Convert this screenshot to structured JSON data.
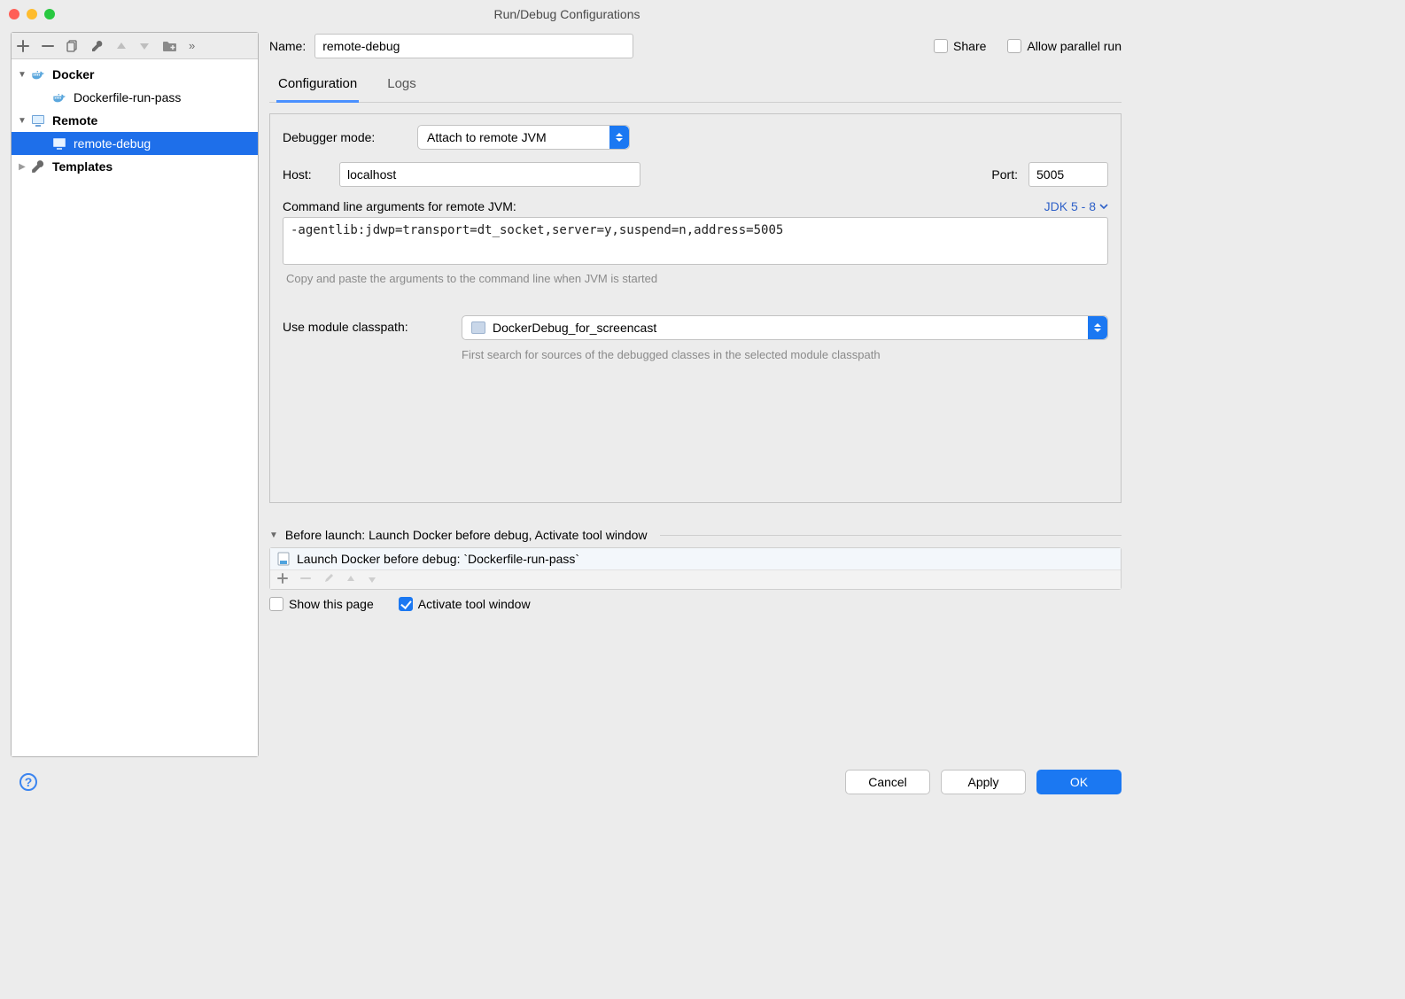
{
  "title": "Run/Debug Configurations",
  "tree": {
    "docker_label": "Docker",
    "docker_item": "Dockerfile-run-pass",
    "remote_label": "Remote",
    "remote_item": "remote-debug",
    "templates_label": "Templates"
  },
  "form": {
    "name_label": "Name:",
    "name_value": "remote-debug",
    "share_label": "Share",
    "allow_parallel_label": "Allow parallel run",
    "tabs": {
      "config": "Configuration",
      "logs": "Logs"
    },
    "debugger_mode_label": "Debugger mode:",
    "debugger_mode_value": "Attach to remote JVM",
    "host_label": "Host:",
    "host_value": "localhost",
    "port_label": "Port:",
    "port_value": "5005",
    "cmdline_label": "Command line arguments for remote JVM:",
    "jdk_label": "JDK 5 - 8",
    "cmdline_value": "-agentlib:jdwp=transport=dt_socket,server=y,suspend=n,address=5005",
    "cmdline_hint": "Copy and paste the arguments to the command line when JVM is started",
    "module_label": "Use module classpath:",
    "module_value": "DockerDebug_for_screencast",
    "module_help": "First search for sources of the debugged classes in the selected module classpath"
  },
  "before_launch": {
    "header": "Before launch: Launch Docker before debug, Activate tool window",
    "item": "Launch Docker before debug: `Dockerfile-run-pass`",
    "show_this_page": "Show this page",
    "activate_tool_window": "Activate tool window"
  },
  "buttons": {
    "cancel": "Cancel",
    "apply": "Apply",
    "ok": "OK"
  }
}
